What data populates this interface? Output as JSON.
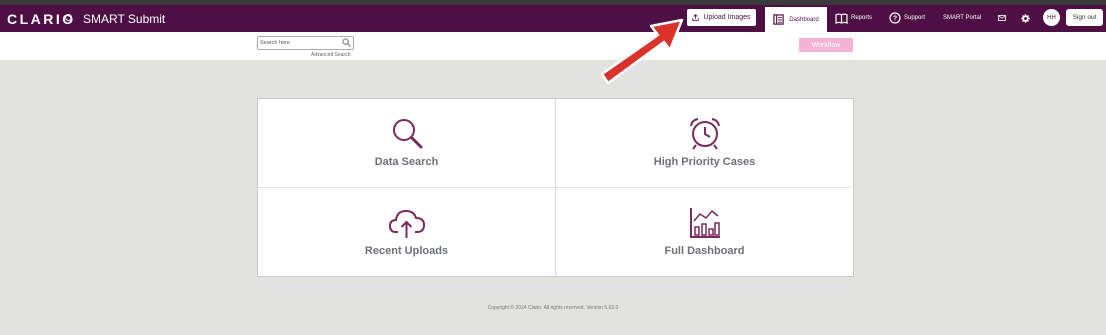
{
  "brand": {
    "logo_text": "CLARIO",
    "app_name": "SMART Submit"
  },
  "nav": {
    "upload_label": "Upload Images",
    "dashboard_label": "Dashboard",
    "reports_label": "Reports",
    "support_label": "Support",
    "portal_label": "SMART Portal",
    "avatar_initials": "HH",
    "signout_label": "Sign out"
  },
  "search": {
    "placeholder": "Search here",
    "advanced_label": "Advanced Search"
  },
  "workflow_label": "Workflow",
  "tiles": [
    {
      "label": "Data Search",
      "icon": "magnifier-icon"
    },
    {
      "label": "High Priority Cases",
      "icon": "alarm-clock-icon"
    },
    {
      "label": "Recent Uploads",
      "icon": "cloud-upload-icon"
    },
    {
      "label": "Full Dashboard",
      "icon": "bar-chart-icon"
    }
  ],
  "footer": "Copyright © 2024 Clario. All rights reserved. Version 5.63.0",
  "colors": {
    "brand": "#4e0f44",
    "icon": "#7a2a5c",
    "workflow": "#f4b3d2",
    "arrow": "#d9332a"
  }
}
